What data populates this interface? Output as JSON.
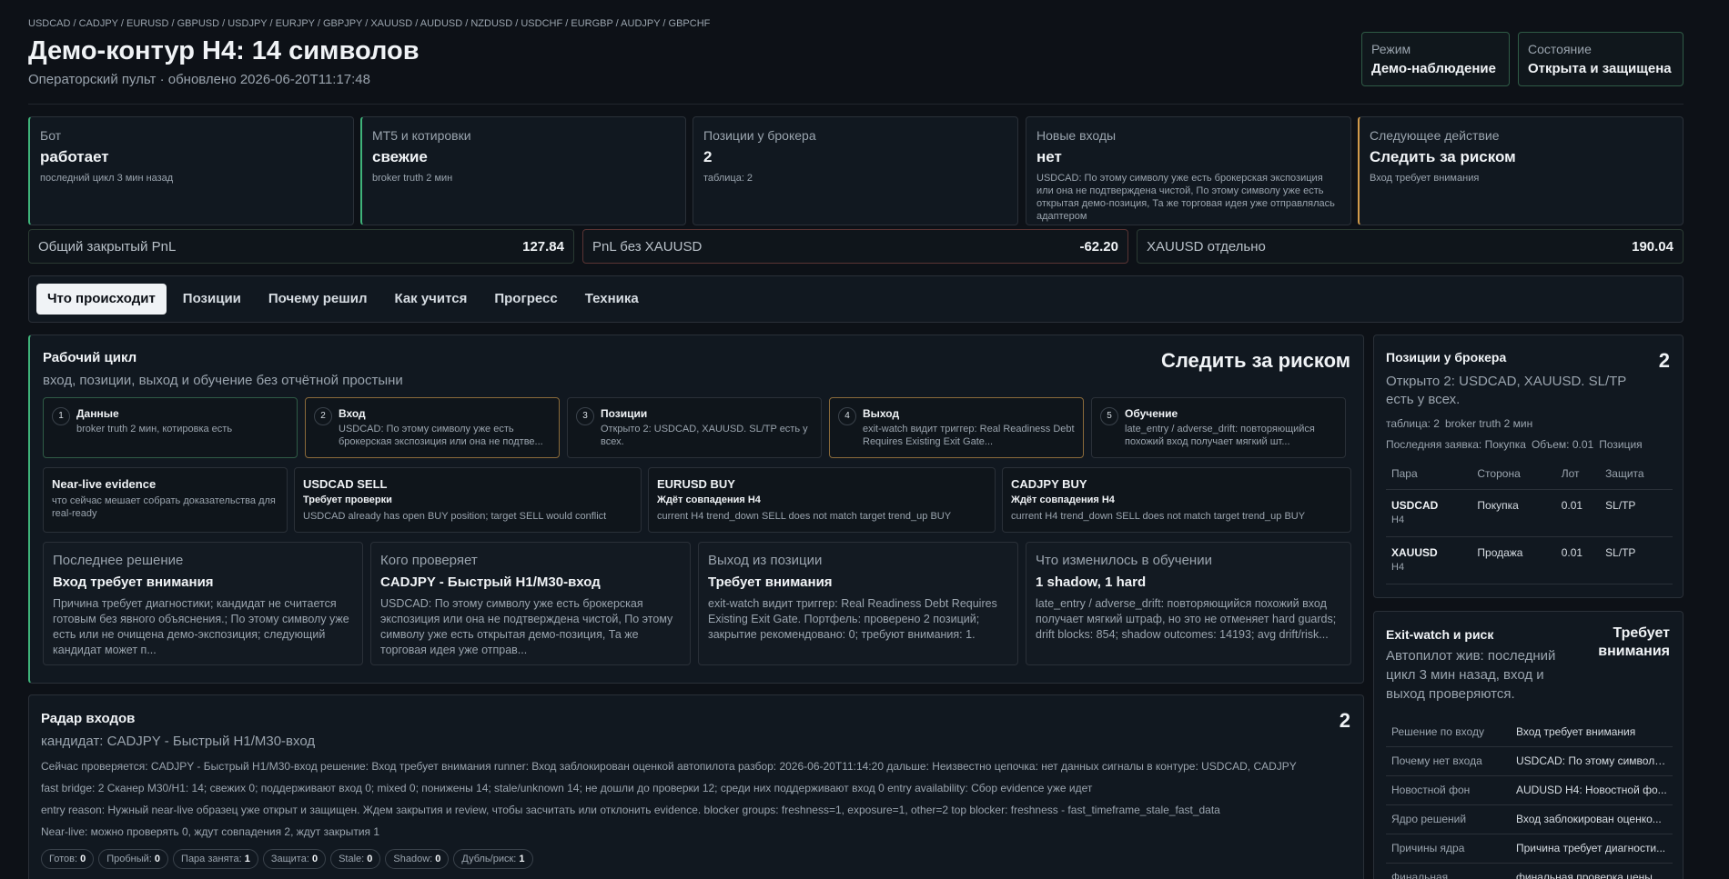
{
  "header": {
    "symbols": "USDCAD / CADJPY / EURUSD / GBPUSD / USDJPY / EURJPY / GBPJPY / XAUUSD / AUDUSD / NZDUSD / USDCHF / EURGBP / AUDJPY / GBPCHF",
    "title": "Демо-контур H4: 14 символов",
    "subtitle": "Операторский пульт · обновлено 2026-06-20T11:17:48",
    "mode_label": "Режим",
    "mode_value": "Демо-наблюдение",
    "state_label": "Состояние",
    "state_value": "Открыта и защищена"
  },
  "cards": [
    {
      "label": "Бот",
      "value": "работает",
      "sub": "последний цикл 3 мин назад"
    },
    {
      "label": "MT5 и котировки",
      "value": "свежие",
      "sub": "broker truth 2 мин"
    },
    {
      "label": "Позиции у брокера",
      "value": "2",
      "sub": "таблица: 2"
    },
    {
      "label": "Новые входы",
      "value": "нет",
      "sub": "USDCAD: По этому символу уже есть брокерская экспозиция или она не подтверждена чистой, По этому символу уже есть открытая демо-позиция, Та же торговая идея уже отправлялась адаптером"
    },
    {
      "label": "Следующее действие",
      "value": "Следить за риском",
      "sub": "Вход требует внимания"
    }
  ],
  "pnl": [
    {
      "label": "Общий закрытый PnL",
      "value": "127.84"
    },
    {
      "label": "PnL без XAUUSD",
      "value": "-62.20"
    },
    {
      "label": "XAUUSD отдельно",
      "value": "190.04"
    }
  ],
  "tabs": [
    "Что происходит",
    "Позиции",
    "Почему решил",
    "Как учится",
    "Прогресс",
    "Техника"
  ],
  "cycle": {
    "title": "Рабочий цикл",
    "subtitle": "вход, позиции, выход и обучение без отчётной простыни",
    "action": "Следить за риском",
    "steps": [
      {
        "n": "1",
        "title": "Данные",
        "desc": "broker truth 2 мин, котировка есть"
      },
      {
        "n": "2",
        "title": "Вход",
        "desc": "USDCAD: По этому символу уже есть брокерская экспозиция или она не подтве..."
      },
      {
        "n": "3",
        "title": "Позиции",
        "desc": "Открыто 2: USDCAD, XAUUSD. SL/TP есть у всех."
      },
      {
        "n": "4",
        "title": "Выход",
        "desc": "exit-watch видит триггер: Real Readiness Debt Requires Existing Exit Gate..."
      },
      {
        "n": "5",
        "title": "Обучение",
        "desc": "late_entry / adverse_drift: повторяющийся похожий вход получает мягкий шт..."
      }
    ],
    "evidence": [
      {
        "title": "Near-live evidence",
        "status": "",
        "desc": "что сейчас мешает собрать доказательства для real-ready"
      },
      {
        "title": "USDCAD SELL",
        "status": "Требует проверки",
        "desc": "USDCAD already has open BUY position; target SELL would conflict"
      },
      {
        "title": "EURUSD BUY",
        "status": "Ждёт совпадения H4",
        "desc": "current H4 trend_down SELL does not match target trend_up BUY"
      },
      {
        "title": "CADJPY BUY",
        "status": "Ждёт совпадения H4",
        "desc": "current H4 trend_down SELL does not match target trend_up BUY"
      }
    ],
    "decisions": [
      {
        "label": "Последнее решение",
        "value": "Вход требует внимания",
        "desc": "Причина требует диагностики; кандидат не считается готовым без явного объяснения.; По этому символу уже есть или не очищена демо-экспозиция; следующий кандидат может п..."
      },
      {
        "label": "Кого проверяет",
        "value": "CADJPY - Быстрый H1/M30-вход",
        "desc": "USDCAD: По этому символу уже есть брокерская экспозиция или она не подтверждена чистой, По этому символу уже есть открытая демо-позиция, Та же торговая идея уже отправ..."
      },
      {
        "label": "Выход из позиции",
        "value": "Требует внимания",
        "desc": "exit-watch видит триггер: Real Readiness Debt Requires Existing Exit Gate. Портфель: проверено 2 позиций; закрытие рекомендовано: 0; требуют внимания: 1."
      },
      {
        "label": "Что изменилось в обучении",
        "value": "1 shadow, 1 hard",
        "desc": "late_entry / adverse_drift: повторяющийся похожий вход получает мягкий штраф, но это не отменяет hard guards; drift blocks: 854; shadow outcomes: 14193; avg drift/risk..."
      }
    ]
  },
  "radar": {
    "title": "Радар входов",
    "count": "2",
    "subtitle": "кандидат: CADJPY - Быстрый H1/M30-вход",
    "lines": [
      "Сейчас проверяется: CADJPY - Быстрый H1/M30-вход  решение: Вход требует внимания  runner: Вход заблокирован оценкой автопилота  разбор: 2026-06-20T11:14:20  дальше: Неизвестно  цепочка: нет данных  сигналы в контуре: USDCAD, CADJPY",
      "fast bridge: 2  Сканер M30/H1: 14; свежих 0; поддерживают вход 0; mixed 0; понижены 14; stale/unknown 14; не дошли до проверки 12; среди них поддерживают вход 0  entry availability: Сбор evidence уже идет",
      "entry reason: Нужный near-live образец уже открыт и защищен. Ждем закрытия и review, чтобы засчитать или отклонить evidence.  blocker groups: freshness=1, exposure=1, other=2  top blocker: freshness - fast_timeframe_stale_fast_data",
      "Near-live: можно проверять 0, ждут совпадения 2, ждут закрытия 1"
    ],
    "chips": [
      {
        "label": "Готов:",
        "value": "0"
      },
      {
        "label": "Пробный:",
        "value": "0"
      },
      {
        "label": "Пара занята:",
        "value": "1"
      },
      {
        "label": "Защита:",
        "value": "0"
      },
      {
        "label": "Stale:",
        "value": "0"
      },
      {
        "label": "Shadow:",
        "value": "0"
      },
      {
        "label": "Дубль/риск:",
        "value": "1"
      }
    ]
  },
  "broker_positions": {
    "title": "Позиции у брокера",
    "count": "2",
    "subtitle": "Открыто 2: USDCAD, XAUUSD. SL/TP есть у всех.",
    "meta1": [
      "таблица: 2",
      "broker truth 2 мин"
    ],
    "meta2": [
      "Последняя заявка: Покупка",
      "Объем: 0.01",
      "Позиция"
    ],
    "columns": [
      "Пара",
      "Сторона",
      "Лот",
      "Защита"
    ],
    "rows": [
      {
        "symbol": "USDCAD",
        "tf": "H4",
        "side": "Покупка",
        "lot": "0.01",
        "protection": "SL/TP"
      },
      {
        "symbol": "XAUUSD",
        "tf": "H4",
        "side": "Продажа",
        "lot": "0.01",
        "protection": "SL/TP"
      }
    ]
  },
  "exit_watch": {
    "title": "Exit-watch и риск",
    "state_line1": "Требует",
    "state_line2": "внимания",
    "subtitle": "Автопилот жив: последний цикл 3 мин назад, вход и выход проверяются.",
    "rows": [
      {
        "k": "Решение по входу",
        "v": "Вход требует внимания"
      },
      {
        "k": "Почему нет входа",
        "v": "USDCAD: По этому символу..."
      },
      {
        "k": "Новостной фон",
        "v": "AUDUSD H4: Новостной фо..."
      },
      {
        "k": "Ядро решений",
        "v": "Вход заблокирован оценко..."
      },
      {
        "k": "Причины ядра",
        "v": "Причина требует диагности..."
      },
      {
        "k": "Финальная",
        "v": "финальная проверка цены"
      }
    ]
  }
}
